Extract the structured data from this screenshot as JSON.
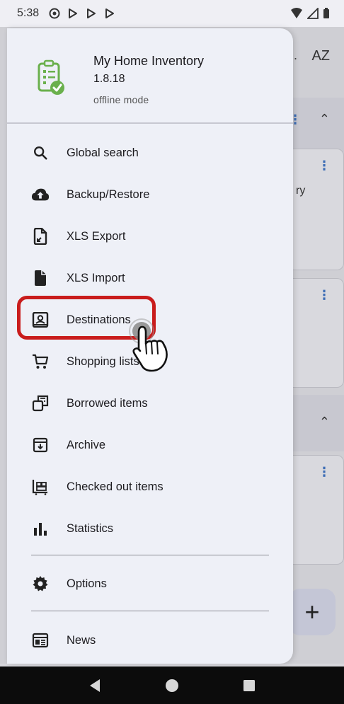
{
  "status_bar": {
    "time": "5:38"
  },
  "background": {
    "sort_label": "AZ",
    "partial_text": "ry",
    "fab_label": "+"
  },
  "drawer": {
    "app_title": "My Home Inventory",
    "app_version": "1.8.18",
    "app_mode": "offline mode",
    "items": [
      {
        "label": "Global search",
        "icon": "search-icon"
      },
      {
        "label": "Backup/Restore",
        "icon": "cloud-upload-icon"
      },
      {
        "label": "XLS Export",
        "icon": "file-export-icon"
      },
      {
        "label": "XLS Import",
        "icon": "file-icon"
      },
      {
        "label": "Destinations",
        "icon": "destination-icon"
      },
      {
        "label": "Shopping lists",
        "icon": "cart-icon"
      },
      {
        "label": "Borrowed items",
        "icon": "borrowed-icon"
      },
      {
        "label": "Archive",
        "icon": "archive-icon"
      },
      {
        "label": "Checked out items",
        "icon": "checked-out-icon"
      },
      {
        "label": "Statistics",
        "icon": "bar-chart-icon"
      },
      {
        "label": "Options",
        "icon": "gear-icon"
      },
      {
        "label": "News",
        "icon": "news-icon"
      }
    ]
  },
  "colors": {
    "highlight": "#c91c1c",
    "logo_green": "#6ab04c",
    "drawer_bg": "#eef0f7"
  }
}
